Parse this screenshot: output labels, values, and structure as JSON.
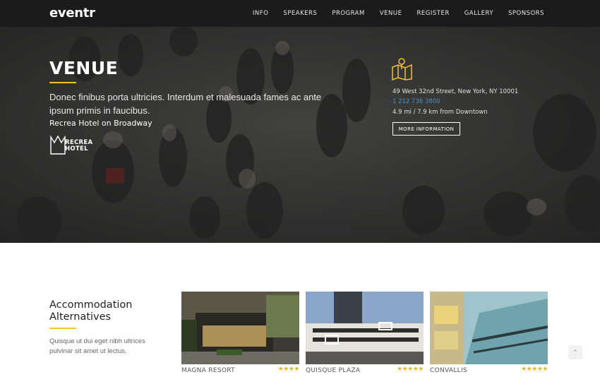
{
  "brand": {
    "logo": "eventr",
    "accent_color": "#f2c230",
    "link_color": "#4a90c8"
  },
  "nav": {
    "items": [
      {
        "label": "INFO"
      },
      {
        "label": "SPEAKERS"
      },
      {
        "label": "PROGRAM"
      },
      {
        "label": "VENUE"
      },
      {
        "label": "REGISTER"
      },
      {
        "label": "GALLERY"
      },
      {
        "label": "SPONSORS"
      }
    ]
  },
  "venue": {
    "title": "VENUE",
    "description": "Donec finibus porta ultricies. Interdum et malesuada fames ac ante ipsum primis in faucibus.",
    "hotel_name": "Recrea Hotel on Broadway",
    "hotel_logo_line1": "RECREA",
    "hotel_logo_line2": "HOTEL",
    "map_icon": "map-pin-icon",
    "address": "49 West 32nd Street, New York, NY 10001",
    "phone": "1 212 736 3800",
    "distance": "4.9 mi / 7.9 km from Downtown",
    "more_button": "MORE INFORMATION"
  },
  "accommodation": {
    "title": "Accommodation Alternatives",
    "description": "Quisque ut dui eget nibh ultrices pulvinar sit amet ut lectus.",
    "hotels": [
      {
        "name": "MAGNA RESORT",
        "stars": "★★★★",
        "rating": 4
      },
      {
        "name": "QUISQUE PLAZA",
        "stars": "★★★★★",
        "rating": 5
      },
      {
        "name": "CONVALLIS",
        "stars": "★★★★★",
        "rating": 5
      }
    ]
  },
  "scroll_top": {
    "icon": "chevron-up-icon",
    "glyph": "⌃"
  }
}
